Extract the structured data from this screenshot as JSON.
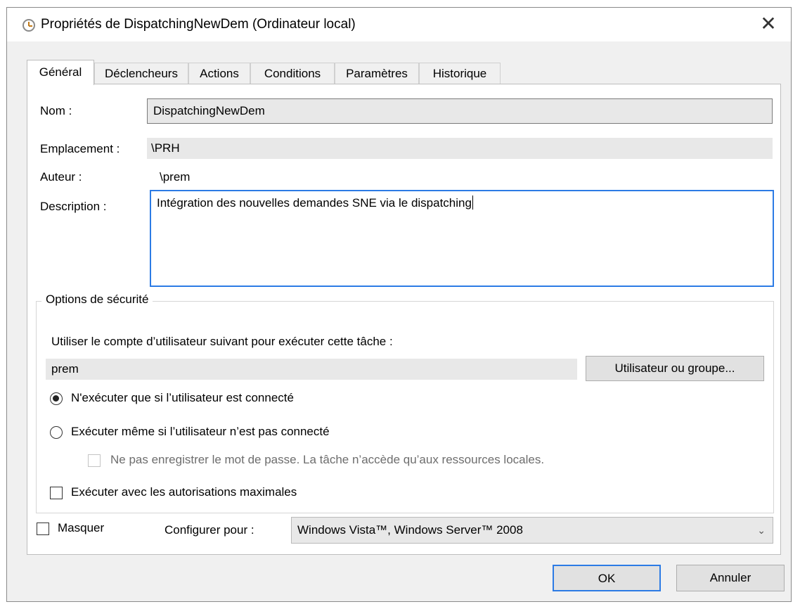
{
  "window": {
    "title": "Propriétés de DispatchingNewDem (Ordinateur local)",
    "close": "✕"
  },
  "tabs": [
    {
      "label": "Général",
      "active": true
    },
    {
      "label": "Déclencheurs"
    },
    {
      "label": "Actions"
    },
    {
      "label": "Conditions"
    },
    {
      "label": "Paramètres"
    },
    {
      "label": "Historique"
    }
  ],
  "general": {
    "name_label": "Nom :",
    "name_value": "DispatchingNewDem",
    "location_label": "Emplacement :",
    "location_value": "\\PRH",
    "author_label": "Auteur :",
    "author_value": "\\prem",
    "description_label": "Description :",
    "description_value": "Intégration des nouvelles demandes SNE via le dispatching"
  },
  "security": {
    "legend": "Options de sécurité",
    "account_prompt": "Utiliser le compte d’utilisateur suivant pour exécuter cette tâche :",
    "account_value": "prem",
    "user_group_button": "Utilisateur ou groupe...",
    "radio_logged_on": "N'exécuter que si l’utilisateur est connecté",
    "radio_logged_on_checked": true,
    "radio_always": "Exécuter même si l’utilisateur n’est pas connecté",
    "radio_always_checked": false,
    "no_store_password": "Ne pas enregistrer le mot de passe. La tâche n’accède qu’aux ressources locales.",
    "highest_privileges": "Exécuter avec les autorisations maximales"
  },
  "footer": {
    "hidden_label": "Masquer",
    "configure_label": "Configurer pour :",
    "configure_value": "Windows Vista™, Windows Server™ 2008",
    "ok": "OK",
    "cancel": "Annuler"
  },
  "colors": {
    "accent": "#2c7be5",
    "dialog_bg": "#f0f0f0"
  }
}
